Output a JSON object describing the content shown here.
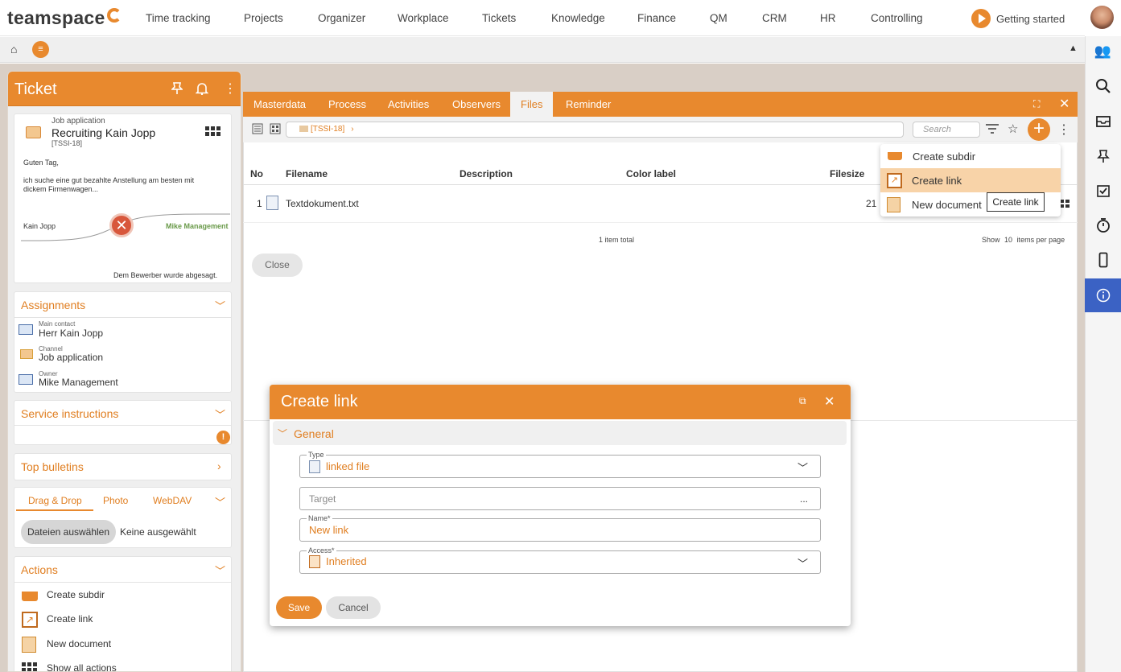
{
  "app": {
    "logo_text": "teamspace"
  },
  "topnav": [
    "Time tracking",
    "Projects",
    "Organizer",
    "Workplace",
    "Tickets",
    "Knowledge",
    "Finance",
    "QM",
    "CRM",
    "HR",
    "Controlling"
  ],
  "getting_started": "Getting started",
  "ticket": {
    "title": "Ticket",
    "type": "Job application",
    "name": "Recruiting Kain Jopp",
    "id": "[TSSI-18]",
    "message_lines": [
      "Guten Tag,",
      "ich suche eine gut bezahlte Anstellung am besten mit",
      "dickem Firmenwagen..."
    ],
    "flow_from": "Kain Jopp",
    "flow_to": "Mike Management",
    "status_text": "Dem Bewerber wurde abgesagt."
  },
  "assignments": {
    "title": "Assignments",
    "items": [
      {
        "label": "Main contact",
        "value": "Herr Kain Jopp"
      },
      {
        "label": "Channel",
        "value": "Job application"
      },
      {
        "label": "Owner",
        "value": "Mike Management"
      }
    ]
  },
  "service_instructions": {
    "title": "Service instructions"
  },
  "top_bulletins": {
    "title": "Top bulletins"
  },
  "upload": {
    "tabs": [
      "Drag & Drop",
      "Photo",
      "WebDAV"
    ],
    "choose_button": "Dateien auswählen",
    "none_selected": "Keine ausgewählt"
  },
  "actions": {
    "title": "Actions",
    "items": [
      "Create subdir",
      "Create link",
      "New document",
      "Show all actions"
    ]
  },
  "main": {
    "tabs": [
      "Masterdata",
      "Process",
      "Activities",
      "Observers",
      "Files",
      "Reminder"
    ],
    "active_tab": "Files",
    "path": "[TSSI-18]",
    "search_placeholder": "Search",
    "columns": [
      "No",
      "Filename",
      "Description",
      "Color label",
      "Filesize"
    ],
    "rows": [
      {
        "no": "1",
        "filename": "Textdokument.txt",
        "filesize": "21"
      }
    ],
    "total": "1 item total",
    "show_label": "Show",
    "per_page": "10",
    "per_page_suffix": "items per page",
    "close_button": "Close"
  },
  "dropdown": {
    "items": [
      "Create subdir",
      "Create link",
      "New document"
    ],
    "highlighted": "Create link",
    "tooltip": "Create link"
  },
  "dialog": {
    "title": "Create link",
    "section": "General",
    "type_label": "Type",
    "type_value": "linked file",
    "target_placeholder": "Target",
    "target_more": "...",
    "name_label": "Name*",
    "name_value": "New link",
    "access_label": "Access*",
    "access_value": "Inherited",
    "save": "Save",
    "cancel": "Cancel"
  },
  "colors": {
    "accent": "#e8892e",
    "info_active": "#3b62c4"
  }
}
